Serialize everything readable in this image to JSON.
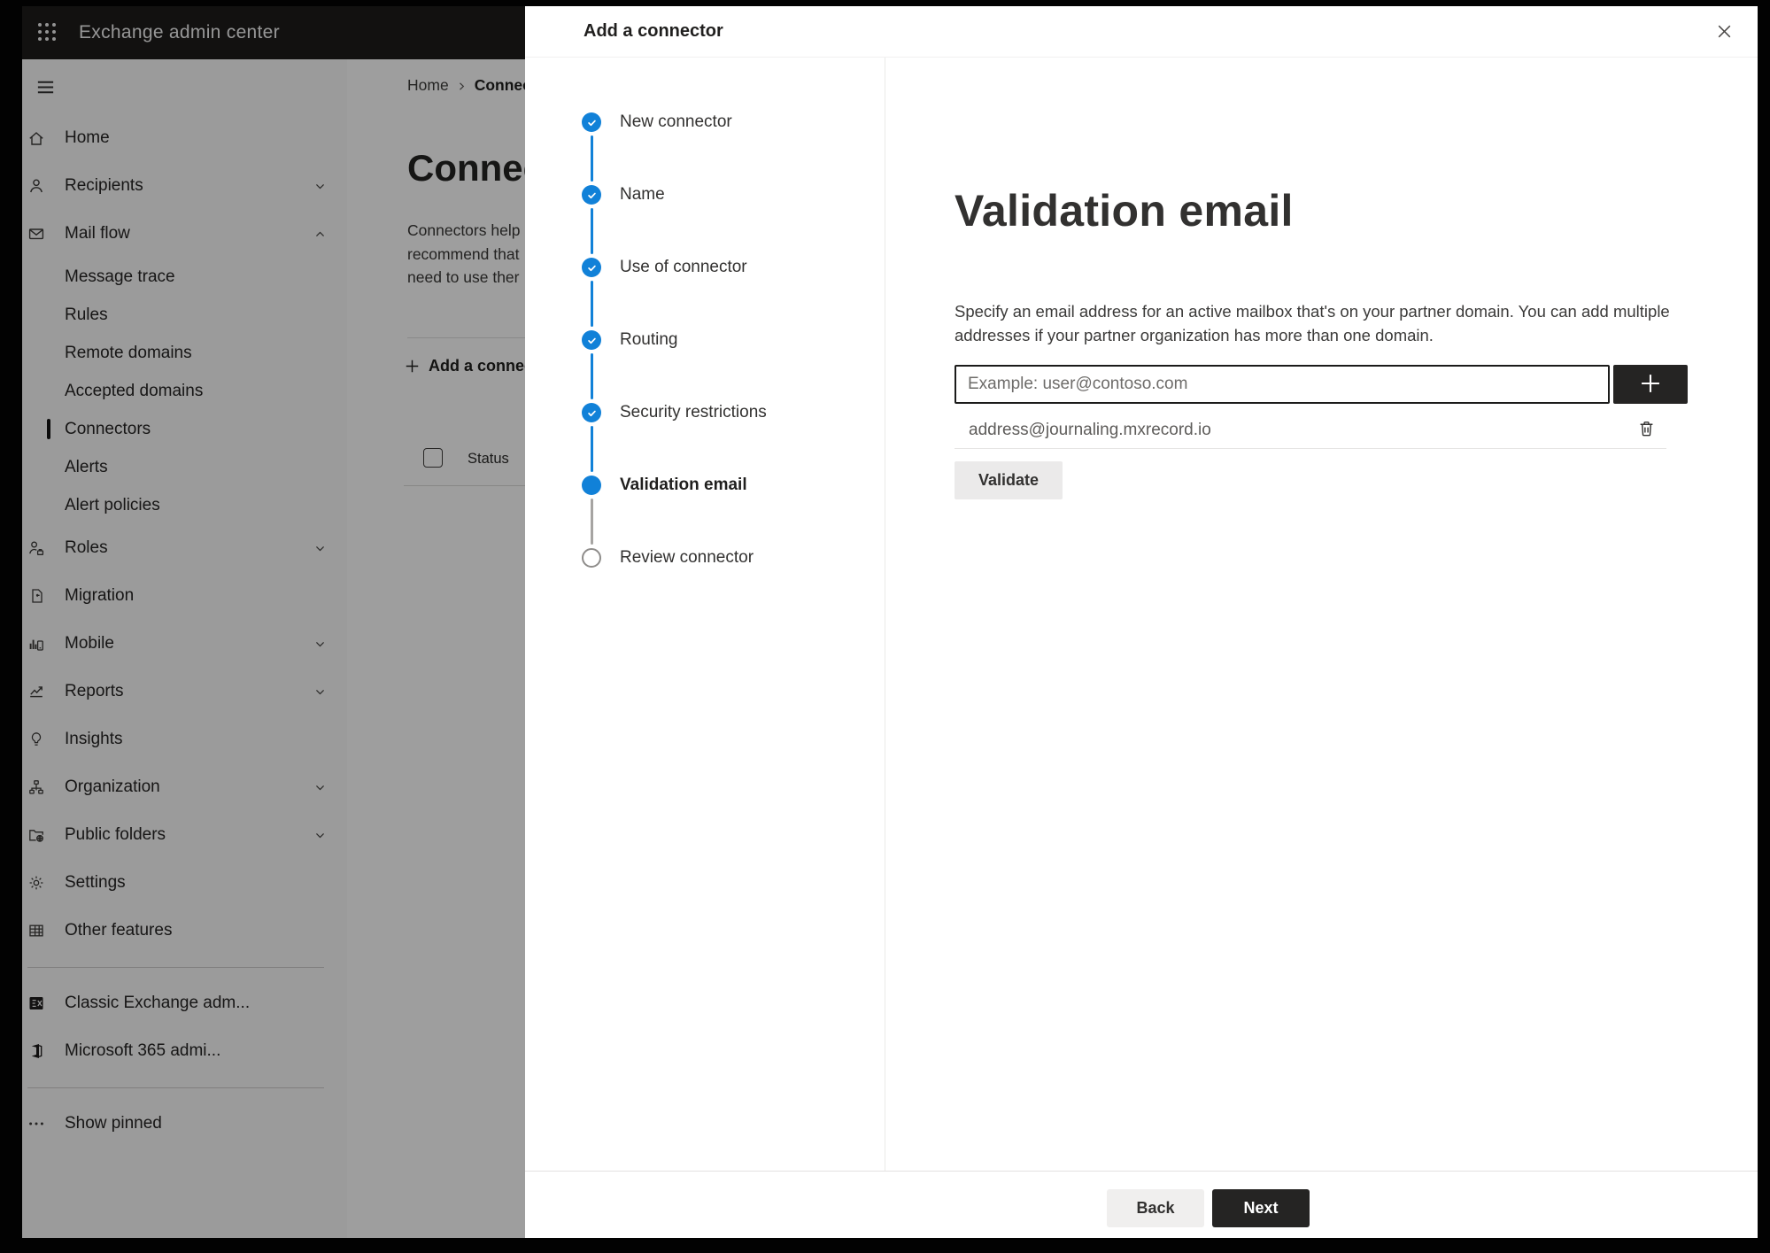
{
  "app_bar": {
    "title": "Exchange admin center"
  },
  "sidebar": {
    "items": [
      {
        "label": "Home",
        "icon": "home-icon"
      },
      {
        "label": "Recipients",
        "icon": "person-icon",
        "chevron": "down"
      },
      {
        "label": "Mail flow",
        "icon": "mail-icon",
        "chevron": "up"
      },
      {
        "label": "Message trace",
        "sub": true
      },
      {
        "label": "Rules",
        "sub": true
      },
      {
        "label": "Remote domains",
        "sub": true
      },
      {
        "label": "Accepted domains",
        "sub": true
      },
      {
        "label": "Connectors",
        "sub": true,
        "selected": true
      },
      {
        "label": "Alerts",
        "sub": true
      },
      {
        "label": "Alert policies",
        "sub": true
      },
      {
        "label": "Roles",
        "icon": "roles-icon",
        "chevron": "down"
      },
      {
        "label": "Migration",
        "icon": "migration-icon"
      },
      {
        "label": "Mobile",
        "icon": "mobile-icon",
        "chevron": "down"
      },
      {
        "label": "Reports",
        "icon": "reports-icon",
        "chevron": "down"
      },
      {
        "label": "Insights",
        "icon": "insights-icon"
      },
      {
        "label": "Organization",
        "icon": "organization-icon",
        "chevron": "down"
      },
      {
        "label": "Public folders",
        "icon": "public-folders-icon",
        "chevron": "down"
      },
      {
        "label": "Settings",
        "icon": "settings-icon"
      },
      {
        "label": "Other features",
        "icon": "other-features-icon"
      },
      {
        "divider": true
      },
      {
        "label": "Classic Exchange adm...",
        "icon": "classic-exchange-icon"
      },
      {
        "label": "Microsoft 365 admi...",
        "icon": "microsoft-365-icon"
      },
      {
        "divider": true
      },
      {
        "label": "Show pinned",
        "icon": "ellipsis-icon"
      }
    ]
  },
  "page": {
    "breadcrumb": {
      "home": "Home",
      "current": "Connectors"
    },
    "title": "Connectors",
    "description_lines": [
      "Connectors help",
      "recommend that",
      "need to use ther"
    ],
    "add_button": "Add a connector",
    "status_header": "Status"
  },
  "panel": {
    "title": "Add a connector",
    "steps": [
      {
        "label": "New connector",
        "state": "completed"
      },
      {
        "label": "Name",
        "state": "completed"
      },
      {
        "label": "Use of connector",
        "state": "completed"
      },
      {
        "label": "Routing",
        "state": "completed"
      },
      {
        "label": "Security restrictions",
        "state": "completed"
      },
      {
        "label": "Validation email",
        "state": "current"
      },
      {
        "label": "Review connector",
        "state": "upcoming"
      }
    ],
    "heading": "Validation email",
    "description": "Specify an email address for an active mailbox that's on your partner domain. You can add multiple addresses if your partner organization has more than one domain.",
    "email_input": {
      "value": "",
      "placeholder": "Example: user@contoso.com"
    },
    "addresses": [
      "address@journaling.mxrecord.io"
    ],
    "validate_label": "Validate",
    "back_label": "Back",
    "next_label": "Next"
  },
  "colors": {
    "accent": "#1181d8",
    "dark_button": "#252423",
    "step_upcoming_gray": "#8f8d8b"
  }
}
